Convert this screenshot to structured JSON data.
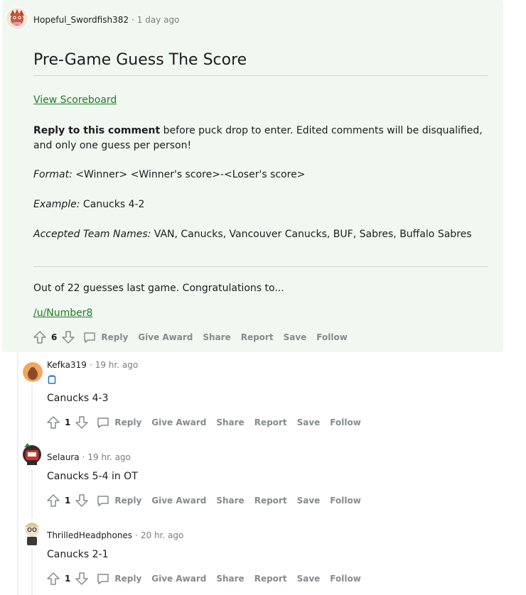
{
  "top": {
    "author": "Hopeful_Swordfish382",
    "time": "1 day ago",
    "title": "Pre-Game Guess The Score",
    "scoreboard_link": "View Scoreboard",
    "reply_bold": "Reply to this comment",
    "reply_rest": " before puck drop to enter. Edited comments will be disqualified, and only one guess per person!",
    "format_label": "Format:",
    "format_value": " <Winner> <Winner's score>-<Loser's score>",
    "example_label": "Example:",
    "example_value": " Canucks 4-2",
    "teams_label": "Accepted Team Names:",
    "teams_value": " VAN, Canucks, Vancouver Canucks, BUF, Sabres, Buffalo Sabres",
    "congrats": "Out of 22 guesses last game. Congratulations to...",
    "winner_link": "/u/Number8",
    "votes": "6"
  },
  "actions": {
    "reply": "Reply",
    "award": "Give Award",
    "share": "Share",
    "report": "Report",
    "save": "Save",
    "follow": "Follow"
  },
  "replies": [
    {
      "author": "Kefka319",
      "time": "19 hr. ago",
      "body": "Canucks 4-3",
      "votes": "1"
    },
    {
      "author": "Selaura",
      "time": "19 hr. ago",
      "body": "Canucks 5-4 in OT",
      "votes": "1"
    },
    {
      "author": "ThrilledHeadphones",
      "time": "20 hr. ago",
      "body": "Canucks 2-1",
      "votes": "1"
    }
  ],
  "sep": "·",
  "colors": {
    "accent_link": "#1f7a26",
    "highlight_bg": "#f1f8f1",
    "flair": "#2a6fd6"
  }
}
